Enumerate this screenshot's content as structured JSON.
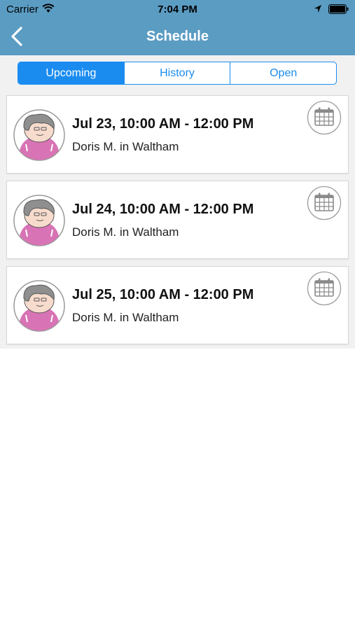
{
  "status_bar": {
    "carrier": "Carrier",
    "time": "7:04 PM"
  },
  "header": {
    "title": "Schedule",
    "back_icon": "chevron-left-icon"
  },
  "tabs": [
    {
      "label": "Upcoming",
      "active": true
    },
    {
      "label": "History",
      "active": false
    },
    {
      "label": "Open",
      "active": false
    }
  ],
  "appointments": [
    {
      "title": "Jul 23, 10:00 AM - 12:00 PM",
      "subtitle": "Doris M. in Waltham"
    },
    {
      "title": "Jul 24, 10:00 AM - 12:00 PM",
      "subtitle": "Doris M. in Waltham"
    },
    {
      "title": "Jul 25, 10:00 AM - 12:00 PM",
      "subtitle": "Doris M. in Waltham"
    }
  ],
  "colors": {
    "header": "#5b9cc3",
    "accent": "#1a8cf0",
    "avatar_sweater": "#d873b5",
    "background": "#f1f1f1"
  }
}
